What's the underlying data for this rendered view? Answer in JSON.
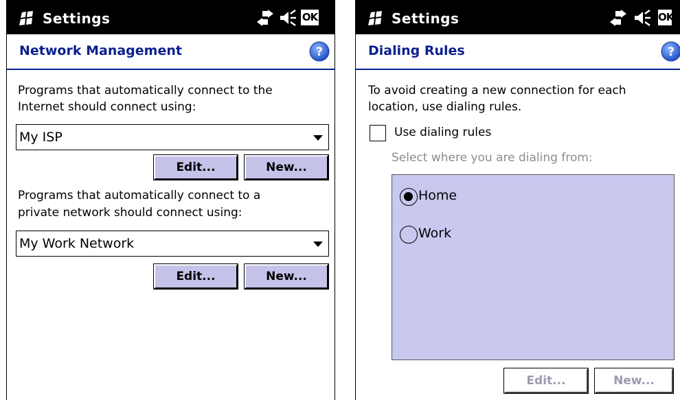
{
  "left_screen": {
    "titlebar": {
      "title": "Settings",
      "ok_label": "OK"
    },
    "header": {
      "title": "Network Management"
    },
    "internet_prompt_line1": "Programs that automatically connect to the",
    "internet_prompt_line2": "Internet should connect using:",
    "internet_selected": "My ISP",
    "edit_label_1": "Edit...",
    "new_label_1": "New...",
    "private_prompt_line1": "Programs that automatically connect to a",
    "private_prompt_line2": "private network should connect using:",
    "private_selected": "My Work Network",
    "edit_label_2": "Edit...",
    "new_label_2": "New..."
  },
  "right_screen": {
    "titlebar": {
      "title": "Settings",
      "ok_label": "OK"
    },
    "header": {
      "title": "Dialing Rules"
    },
    "intro_line1": "To avoid creating a new connection for each",
    "intro_line2": "location, use dialing rules.",
    "use_dialing_rules_label": "Use dialing rules",
    "use_dialing_rules_checked": false,
    "select_prompt": "Select where you are dialing from:",
    "locations": [
      {
        "label": "Home",
        "selected": true
      },
      {
        "label": "Work",
        "selected": false
      }
    ],
    "edit_label": "Edit...",
    "new_label": "New..."
  },
  "colors": {
    "titlebar_bg": "#000000",
    "header_text": "#0a1f8f",
    "button_bg": "#c6c3ea",
    "list_panel_bg": "#c9c8ef",
    "disabled_text": "#9b9bb0"
  },
  "icons": [
    "windows-start-icon",
    "connectivity-arrows-icon",
    "speaker-icon",
    "help-icon"
  ]
}
